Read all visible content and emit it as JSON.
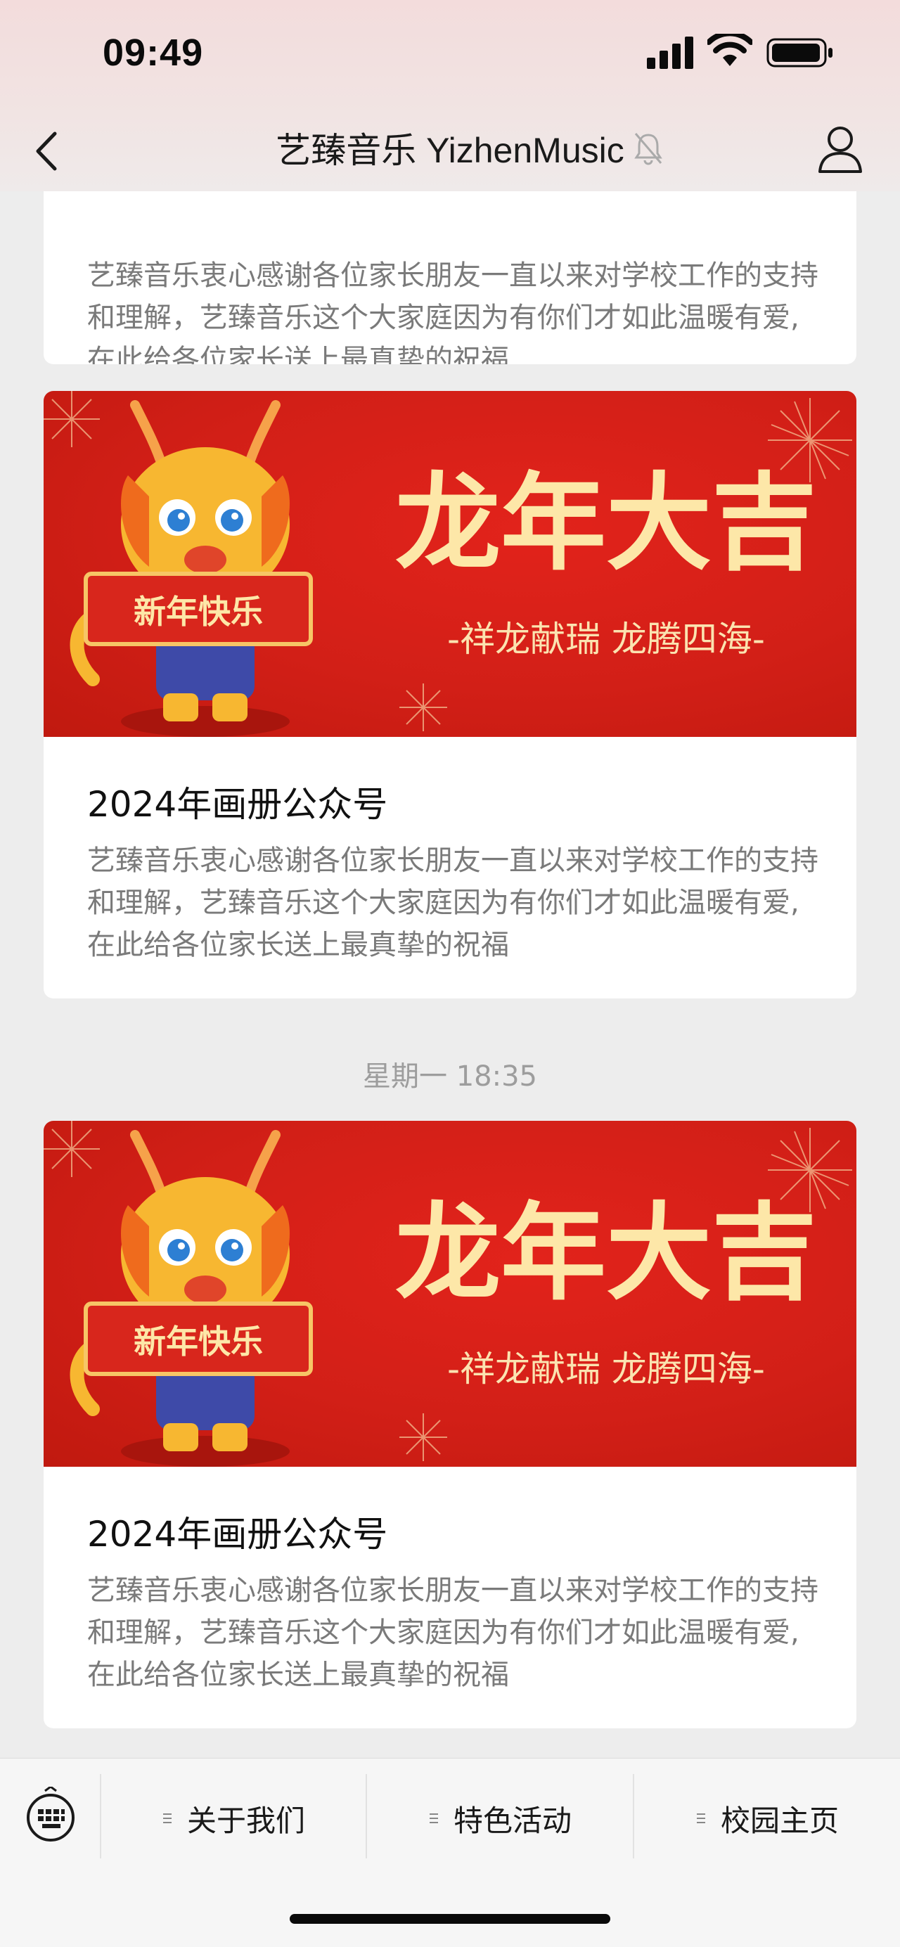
{
  "status_bar": {
    "time": "09:49"
  },
  "nav": {
    "title": "艺臻音乐 YizhenMusic"
  },
  "feed": {
    "items": [
      {
        "description": "艺臻音乐衷心感谢各位家长朋友一直以来对学校工作的支持和理解，艺臻音乐这个大家庭因为有你们才如此温暖有爱,在此给各位家长送上最真挚的祝福"
      },
      {
        "banner": {
          "headline": "龙年大吉",
          "subline": "-祥龙献瑞 龙腾四海-",
          "scroll_text": "新年快乐"
        },
        "title": "2024年画册公众号",
        "description": "艺臻音乐衷心感谢各位家长朋友一直以来对学校工作的支持和理解，艺臻音乐这个大家庭因为有你们才如此温暖有爱,在此给各位家长送上最真挚的祝福"
      },
      {
        "banner": {
          "headline": "龙年大吉",
          "subline": "-祥龙献瑞 龙腾四海-",
          "scroll_text": "新年快乐"
        },
        "title": "2024年画册公众号",
        "description": "艺臻音乐衷心感谢各位家长朋友一直以来对学校工作的支持和理解，艺臻音乐这个大家庭因为有你们才如此温暖有爱,在此给各位家长送上最真挚的祝福"
      }
    ],
    "timestamp": "星期一 18:35"
  },
  "bottom_menu": {
    "items": [
      {
        "label": "关于我们"
      },
      {
        "label": "特色活动"
      },
      {
        "label": "校园主页"
      }
    ]
  },
  "colors": {
    "banner_red": "#d21f17",
    "banner_gold": "#ffe9b8",
    "text_primary": "#111111",
    "text_secondary": "#7a7a7a"
  },
  "icons": [
    "back-icon",
    "mute-bell-icon",
    "profile-icon",
    "keyboard-icon",
    "menu-lines-icon",
    "wifi-icon",
    "signal-icon",
    "battery-icon",
    "dragon-mascot-icon",
    "firework-icon"
  ]
}
